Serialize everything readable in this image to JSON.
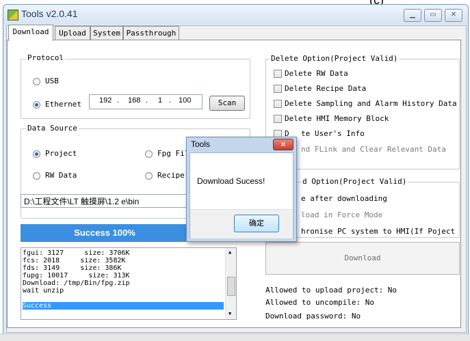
{
  "corner_label": "(c)",
  "window": {
    "title": "Tools v2.0.41",
    "minimize_icon": "minimize-icon",
    "maximize_icon": "maximize-icon",
    "close_icon": "close-icon"
  },
  "tabs": [
    {
      "label": "Download",
      "active": true
    },
    {
      "label": "Upload",
      "active": false
    },
    {
      "label": "System",
      "active": false
    },
    {
      "label": "Passthrough",
      "active": false
    }
  ],
  "protocol": {
    "group_label": "Protocol",
    "usb_label": "USB",
    "ethernet_label": "Ethernet",
    "selected": "Ethernet",
    "ip": [
      "192",
      "168",
      "1",
      "100"
    ],
    "scan_label": "Scan"
  },
  "data_source": {
    "group_label": "Data Source",
    "options": [
      "Project",
      "Fpg Fil",
      "RW Data",
      "Recipe"
    ],
    "selected": "Project",
    "path": "D:\\工程文件\\LT 触摸屏\\1.2 e\\bin"
  },
  "progress": {
    "text": "Success 100%",
    "value": 1.0
  },
  "log": {
    "lines": [
      "fgui: 3127     size: 3706K",
      "fcs: 2018     size: 3582K",
      "fds: 3149     size: 386K",
      "fupg: 10017     size: 313K",
      "Download: /tmp/Bin/fpg.zip",
      "wait unzip",
      "Success"
    ],
    "selected_index": 6
  },
  "delete_option": {
    "group_label": "Delete Option(Project Valid)",
    "items": [
      "Delete RW Data",
      "Delete Recipe Data",
      "Delete Sampling and Alarm History Data",
      "Delete HMI Memory Block",
      "te User's Info",
      "nd FLink and Clear Relevant Data"
    ],
    "item4_prefix": "D"
  },
  "download_option": {
    "group_label": "d Option(Project Valid)",
    "items": [
      "e after downloading",
      "load in Force Mode",
      "hronise PC system to HMI(If Poject"
    ]
  },
  "download_button": "Download",
  "info": {
    "upload": "Allowed to upload project: No",
    "uncompile": "Allowed to uncompile: No",
    "password": "Download password: No"
  },
  "dialog": {
    "title": "Tools",
    "message": "Download Sucess!",
    "ok_label": "确定",
    "close_icon": "close-icon"
  },
  "colors": {
    "accent": "#3b8fe0",
    "selection": "#3399ff",
    "window_frame": "#dfe9f5"
  }
}
